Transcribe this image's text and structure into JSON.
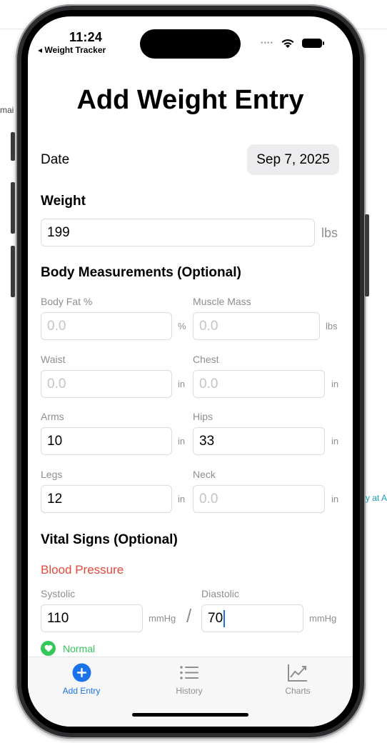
{
  "status_bar": {
    "time": "11:24",
    "back_label": "◂ Weight Tracker"
  },
  "header": {
    "title": "Add Weight Entry"
  },
  "date": {
    "label": "Date",
    "value": "Sep 7, 2025"
  },
  "weight": {
    "section_title": "Weight",
    "value": "199",
    "unit": "lbs"
  },
  "body_measurements": {
    "section_title": "Body Measurements (Optional)",
    "body_fat": {
      "label": "Body Fat %",
      "placeholder": "0.0",
      "unit": "%"
    },
    "muscle_mass": {
      "label": "Muscle Mass",
      "placeholder": "0.0",
      "unit": "lbs"
    },
    "waist": {
      "label": "Waist",
      "placeholder": "0.0",
      "unit": "in"
    },
    "chest": {
      "label": "Chest",
      "placeholder": "0.0",
      "unit": "in"
    },
    "arms": {
      "label": "Arms",
      "value": "10",
      "unit": "in"
    },
    "hips": {
      "label": "Hips",
      "value": "33",
      "unit": "in"
    },
    "legs": {
      "label": "Legs",
      "value": "12",
      "unit": "in"
    },
    "neck": {
      "label": "Neck",
      "placeholder": "0.0",
      "unit": "in"
    }
  },
  "vital_signs": {
    "section_title": "Vital Signs (Optional)",
    "blood_pressure_title": "Blood Pressure",
    "systolic": {
      "label": "Systolic",
      "value": "110",
      "unit": "mmHg"
    },
    "diastolic": {
      "label": "Diastolic",
      "value": "70",
      "unit": "mmHg"
    },
    "separator": "/",
    "status": "Normal"
  },
  "tabs": [
    {
      "label": "Add Entry",
      "icon": "plus-circle-icon",
      "active": true
    },
    {
      "label": "History",
      "icon": "list-icon",
      "active": false
    },
    {
      "label": "Charts",
      "icon": "chart-icon",
      "active": false
    }
  ],
  "background": {
    "left_fragment": "mai",
    "right_fragment": "ay at A"
  },
  "colors": {
    "accent": "#1a73e8",
    "danger": "#e5473b",
    "success": "#34c759"
  }
}
